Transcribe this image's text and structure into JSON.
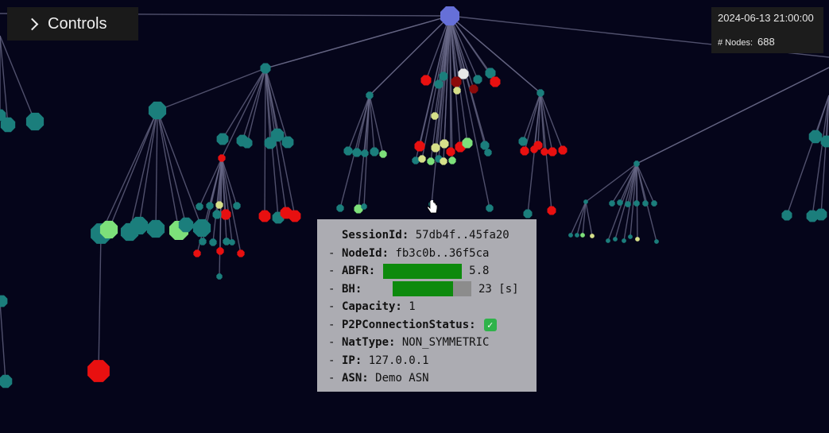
{
  "controls": {
    "label": "Controls"
  },
  "info": {
    "timestamp": "2024-06-13 21:00:00",
    "nodes_label": "# Nodes:",
    "nodes_count": "688"
  },
  "tooltip": {
    "rows": [
      {
        "prefix": "",
        "key": "SessionId:",
        "value": "57db4f..45fa20"
      },
      {
        "prefix": "-",
        "key": "NodeId:",
        "value": "fb3c0b..36f5ca"
      },
      {
        "prefix": "-",
        "key": "ABFR:",
        "value": "5.8"
      },
      {
        "prefix": "-",
        "key": "BH:",
        "value": "23 [s]"
      },
      {
        "prefix": "-",
        "key": "Capacity:",
        "value": "1"
      },
      {
        "prefix": "-",
        "key": "P2PConnectionStatus:",
        "value": ""
      },
      {
        "prefix": "-",
        "key": "NatType:",
        "value": "NON_SYMMETRIC"
      },
      {
        "prefix": "-",
        "key": "IP:",
        "value": "127.0.0.1"
      },
      {
        "prefix": "-",
        "key": "ASN:",
        "value": "Demo ASN"
      }
    ],
    "abfr_fraction": 1.0,
    "bh_fraction": 0.77,
    "p2p_status_icon": "check-mark-icon"
  },
  "colors": {
    "background": "#05051a",
    "root": "#6670d8",
    "teal": "#1b7e7c",
    "red": "#e81010",
    "light_green": "#7de07a",
    "yellow_green": "#d6e08a",
    "dark_red": "#8c0a0a",
    "white": "#e8e8e8",
    "edge": "#6a6a88"
  }
}
